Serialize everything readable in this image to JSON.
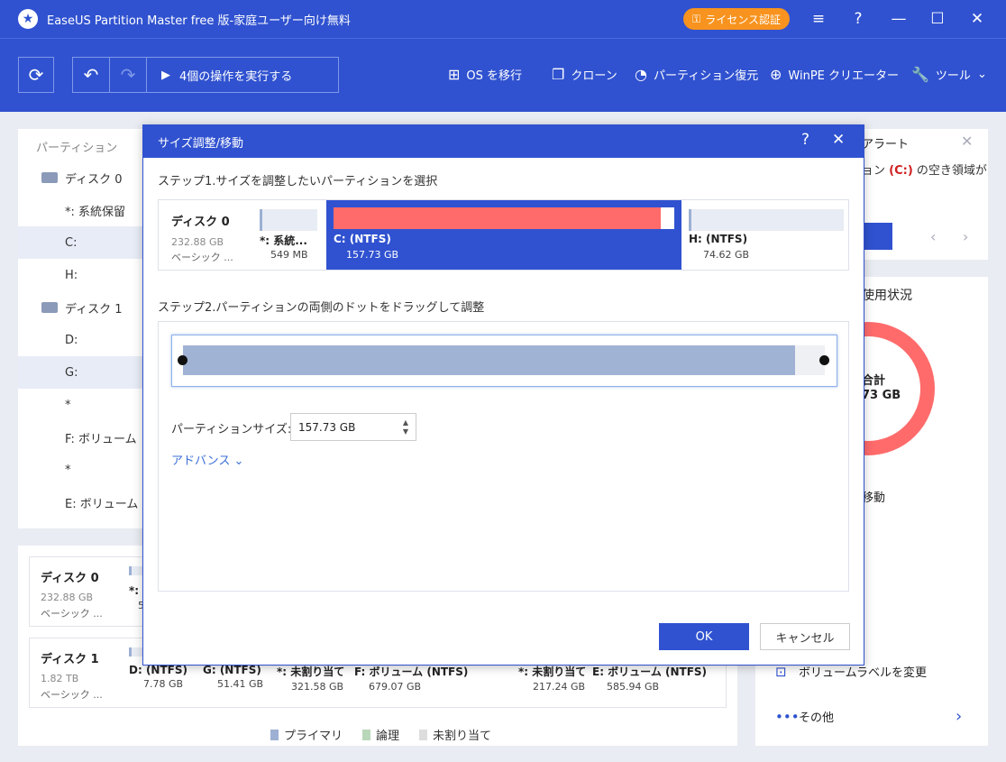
{
  "app": {
    "title": "EaseUS Partition Master free 版-家庭ユーザー向け無料",
    "license_label": "ライセンス認証"
  },
  "toolbar": {
    "execute_label": "4個の操作を実行する",
    "items": [
      {
        "label": "OS を移行",
        "icon": "windows-icon"
      },
      {
        "label": "クローン",
        "icon": "clone-icon"
      },
      {
        "label": "パーティション復元",
        "icon": "pie-icon"
      },
      {
        "label": "WinPE クリエーター",
        "icon": "plus-circle-icon"
      },
      {
        "label": "ツール",
        "icon": "wrench-icon"
      }
    ]
  },
  "left_panel": {
    "header": "パーティション",
    "tree": [
      {
        "label": "ディスク 0",
        "kind": "disk"
      },
      {
        "label": "*: 系統保留",
        "kind": "part"
      },
      {
        "label": "C:",
        "kind": "part",
        "selected": true
      },
      {
        "label": "H:",
        "kind": "part"
      },
      {
        "label": "ディスク 1",
        "kind": "disk"
      },
      {
        "label": "D:",
        "kind": "part"
      },
      {
        "label": "G:",
        "kind": "part",
        "selected": true
      },
      {
        "label": "*",
        "kind": "part"
      },
      {
        "label": "F: ボリューム",
        "kind": "part"
      },
      {
        "label": "*",
        "kind": "part"
      },
      {
        "label": "E: ボリューム",
        "kind": "part"
      }
    ]
  },
  "disk_map": {
    "disk0": {
      "name": "ディスク 0",
      "size": "232.88 GB",
      "type": "ベーシック ...",
      "partial_label": "*: 系",
      "partial_size": "5"
    },
    "disk1": {
      "name": "ディスク 1",
      "size": "1.82 TB",
      "type": "ベーシック ...",
      "partitions": [
        {
          "label": "D: (NTFS)",
          "size": "7.78 GB"
        },
        {
          "label": "G: (NTFS)",
          "size": "51.41 GB"
        },
        {
          "label": "*: 未割り当て",
          "size": "321.58 GB"
        },
        {
          "label": "F: ボリューム (NTFS)",
          "size": "679.07 GB"
        },
        {
          "label": "*: 未割り当て",
          "size": "217.24 GB"
        },
        {
          "label": "E: ボリューム (NTFS)",
          "size": "585.94 GB"
        }
      ]
    },
    "legend": [
      {
        "label": "プライマリ",
        "color": "#9db0d4"
      },
      {
        "label": "論理",
        "color": "#b9d7b9"
      },
      {
        "label": "未割り当て",
        "color": "#dddddd"
      }
    ]
  },
  "right_panel": {
    "alert_title": "アラート",
    "alert_text_prefix": "ョン ",
    "alert_drive": "(C:)",
    "alert_text_suffix": " の空き領域が",
    "usage_title": "使用状況",
    "total_label": "合計",
    "total_value": "73 GB",
    "move_label": "移動",
    "actions": [
      {
        "label": "ボリュームラベルを変更",
        "icon": "label-icon"
      },
      {
        "label": "その他",
        "icon": "more-icon"
      }
    ]
  },
  "modal": {
    "title": "サイズ調整/移動",
    "step1": "ステップ1.サイズを調整したいパーティションを選択",
    "step2": "ステップ2.パーティションの両側のドットをドラッグして調整",
    "disk": {
      "name": "ディスク 0",
      "size": "232.88 GB",
      "type": "ベーシック ..."
    },
    "partitions": [
      {
        "label": "*: 系統...",
        "size": "549 MB"
      },
      {
        "label": "C: (NTFS)",
        "size": "157.73 GB",
        "used_fraction": 0.96
      },
      {
        "label": "H: (NTFS)",
        "size": "74.62 GB"
      }
    ],
    "slider_fill_fraction": 0.953,
    "size_label": "パーティションサイズ:",
    "size_value": "157.73 GB",
    "advanced_label": "アドバンス",
    "ok_label": "OK",
    "cancel_label": "キャンセル"
  },
  "colors": {
    "accent": "#3052d0",
    "used": "#ff6b6b",
    "license": "#f7931e"
  }
}
